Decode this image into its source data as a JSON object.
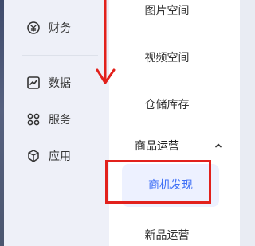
{
  "sidebar": {
    "items": [
      {
        "label": "财务",
        "icon": "yen-icon"
      },
      {
        "label": "数据",
        "icon": "chart-icon"
      },
      {
        "label": "服务",
        "icon": "services-icon"
      },
      {
        "label": "应用",
        "icon": "cube-icon"
      }
    ]
  },
  "submenu": {
    "items": [
      {
        "label": "图片空间"
      },
      {
        "label": "视频空间"
      },
      {
        "label": "仓储库存"
      }
    ],
    "group": {
      "label": "商品运营",
      "icon": "chevron-up-icon"
    },
    "active_item": "商机发现",
    "next_item": "新品运营"
  },
  "annotations": {
    "arrow_color": "#e2211c",
    "box_color": "#e2211c"
  }
}
